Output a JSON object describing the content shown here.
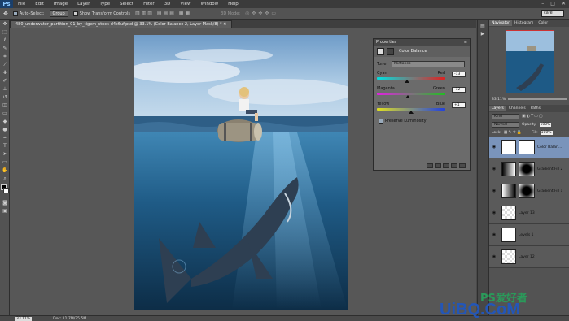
{
  "app": {
    "logo": "Ps"
  },
  "menu": [
    "File",
    "Edit",
    "Image",
    "Layer",
    "Type",
    "Select",
    "Filter",
    "3D",
    "View",
    "Window",
    "Help"
  ],
  "options": {
    "auto_select_label": "Auto-Select:",
    "auto_select_value": "Group",
    "transform_label": "Show Transform Controls",
    "mode_3d": "3D Mode:",
    "workspace": "cafe"
  },
  "doc_tab": "480_underwater_partition_01_by_tigem_stock-d4c6uf.psd @ 33.1% (Color Balance 2, Layer Mask/8) *",
  "properties": {
    "tab": "Properties",
    "title": "Color Balance",
    "tone_label": "Tone:",
    "tone_value": "Midtones",
    "sliders": [
      {
        "left": "Cyan",
        "right": "Red",
        "value": "-13",
        "pos": 0.44
      },
      {
        "left": "Magenta",
        "right": "Green",
        "value": "-12",
        "pos": 0.45
      },
      {
        "left": "Yellow",
        "right": "Blue",
        "value": "+1",
        "pos": 0.5
      }
    ],
    "preserve_label": "Preserve Luminosity"
  },
  "navigator": {
    "tabs": [
      "Navigator",
      "Histogram",
      "Color"
    ],
    "zoom": "33.11%"
  },
  "layers_panel": {
    "tabs": [
      "Layers",
      "Channels",
      "Paths"
    ],
    "kind": "Kind",
    "blend": "Normal",
    "opacity_label": "Opacity:",
    "opacity": "100%",
    "lock_label": "Lock:",
    "fill_label": "Fill:",
    "fill": "100%",
    "layers": [
      {
        "name": "Color Balan...",
        "selected": true
      },
      {
        "name": "Gradient Fill 2",
        "selected": false
      },
      {
        "name": "Gradient Fill 1",
        "selected": false
      },
      {
        "name": "Layer 13",
        "selected": false
      },
      {
        "name": "Levels 1",
        "selected": false
      },
      {
        "name": "Layer 12",
        "selected": false
      }
    ]
  },
  "status": {
    "zoom": "33.11%",
    "doc": "Doc: 11.7M/75.5M"
  },
  "watermarks": {
    "ps": "PS爱好者",
    "uibq": "UiBQ.CoM"
  },
  "colors": {
    "accent_blue": "#1a3f6b",
    "water": "#1c4a6e",
    "selected_layer": "#7a94bb"
  }
}
